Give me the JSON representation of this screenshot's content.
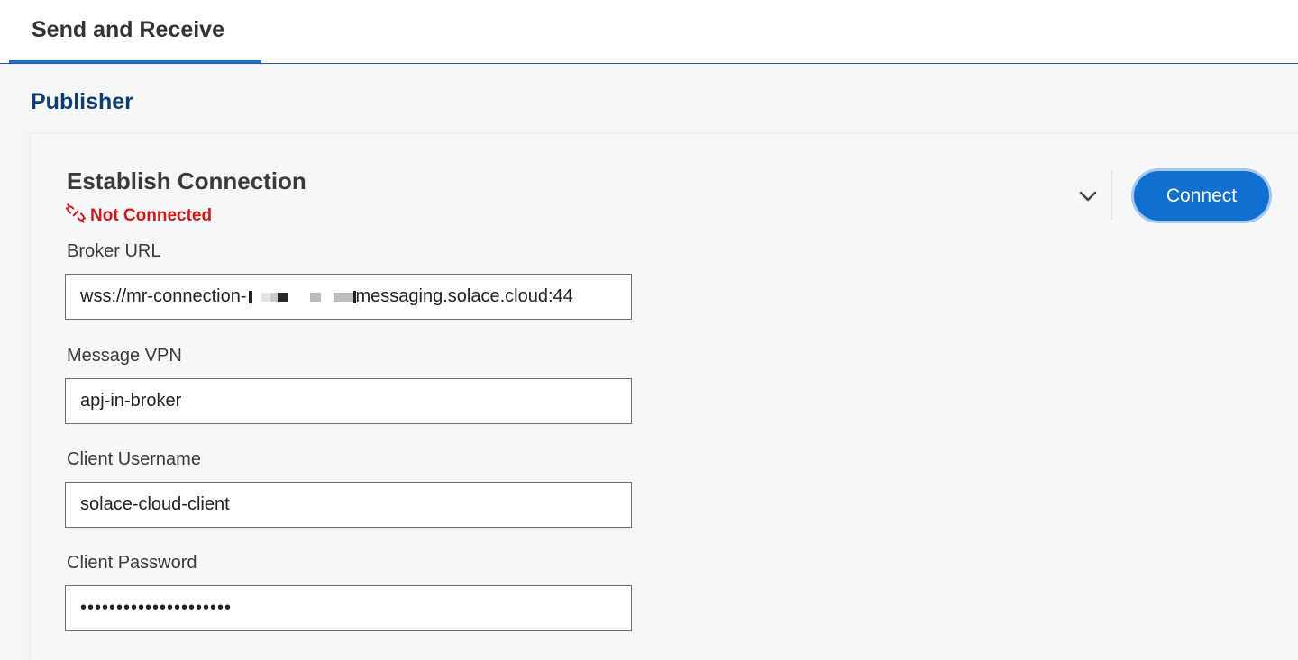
{
  "tabs": [
    {
      "label": "Send and Receive",
      "active": true
    }
  ],
  "publisher": {
    "section_title": "Publisher",
    "card": {
      "title": "Establish Connection",
      "status": "Not Connected",
      "connect_label": "Connect",
      "fields": {
        "broker_url": {
          "label": "Broker URL",
          "value_start": "wss://mr-connection-",
          "value_end": "messaging.solace.cloud:44"
        },
        "message_vpn": {
          "label": "Message VPN",
          "value": "apj-in-broker"
        },
        "client_username": {
          "label": "Client Username",
          "value": "solace-cloud-client"
        },
        "client_password": {
          "label": "Client Password",
          "value": "•••••••••••••••••••••"
        }
      }
    }
  },
  "icons": {
    "status": "broken-link-icon",
    "expand": "chevron-down-icon"
  },
  "colors": {
    "accent": "#1170cf",
    "heading": "#0f3e73",
    "error": "#d0191f",
    "tab_underline": "#1f6bd1"
  }
}
